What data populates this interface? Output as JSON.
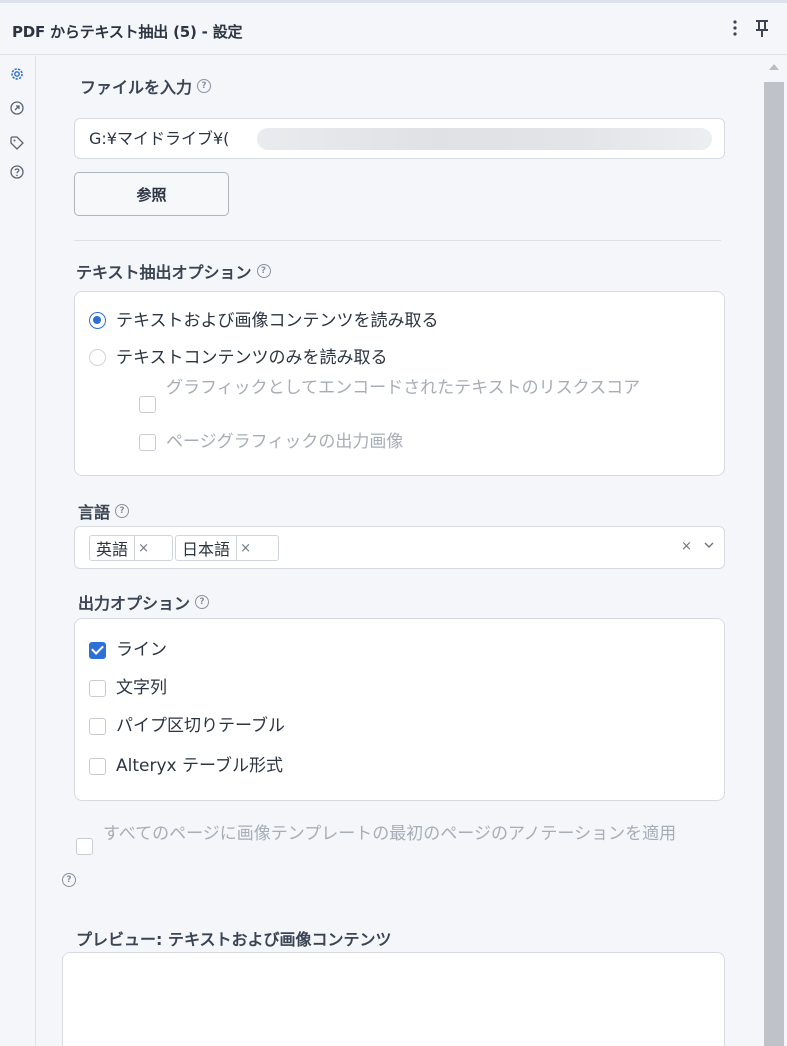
{
  "header": {
    "title": "PDF からテキスト抽出 (5) - 設定",
    "menu_icon": "kebab-menu-icon",
    "pin_icon": "pin-icon"
  },
  "rail": {
    "icons": [
      "gear-icon",
      "arrow-circle-icon",
      "tag-icon",
      "help-circle-icon"
    ]
  },
  "file_section": {
    "label": "ファイルを入力",
    "value": "G:¥マイドライブ¥(",
    "browse_label": "参照"
  },
  "extract_section": {
    "label": "テキスト抽出オプション",
    "radio_1": "テキストおよび画像コンテンツを読み取る",
    "radio_2": "テキストコンテンツのみを読み取る",
    "sub_1": "グラフィックとしてエンコードされたテキストのリスクスコア",
    "sub_2": "ページグラフィックの出力画像",
    "selected": "radio_1"
  },
  "language_section": {
    "label": "言語",
    "tags": [
      "英語",
      "日本語"
    ],
    "clear": "×"
  },
  "output_section": {
    "label": "出力オプション",
    "options": [
      {
        "label": "ライン",
        "checked": true
      },
      {
        "label": "文字列",
        "checked": false
      },
      {
        "label": "パイプ区切りテーブル",
        "checked": false
      },
      {
        "label": "Alteryx テーブル形式",
        "checked": false
      }
    ]
  },
  "apply_option": {
    "label": "すべてのページに画像テンプレートの最初のページのアノテーションを適用",
    "checked": false
  },
  "preview": {
    "label": "プレビュー: テキストおよび画像コンテンツ"
  },
  "colors": {
    "accent": "#2c6fd6",
    "background": "#f4f6fa",
    "muted_text": "#a7adb6"
  }
}
